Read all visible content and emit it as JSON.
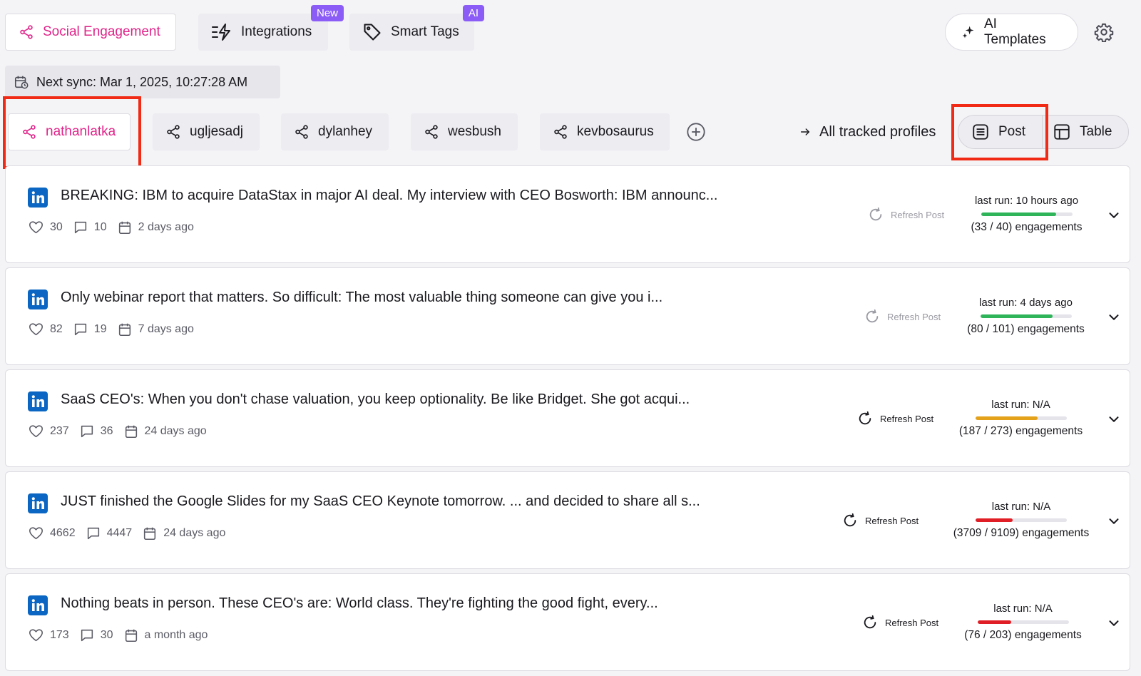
{
  "top_tabs": {
    "social": "Social Engagement",
    "integrations": "Integrations",
    "integrations_badge": "New",
    "smart_tags": "Smart Tags",
    "smart_tags_badge": "AI"
  },
  "ai_templates": "AI Templates",
  "sync": "Next sync: Mar 1, 2025, 10:27:28 AM",
  "profiles": [
    "nathanlatka",
    "ugljesadj",
    "dylanhey",
    "wesbush",
    "kevbosaurus"
  ],
  "all_profiles": "All tracked profiles",
  "view": {
    "post": "Post",
    "table": "Table"
  },
  "colors": {
    "accent": "#e0248a",
    "badge": "#8b5cf6",
    "green": "#2fb45a",
    "orange": "#e3a21a",
    "red": "#e01e25",
    "linkedin": "#0a66c2"
  },
  "posts": [
    {
      "text": "BREAKING: IBM to acquire DataStax in major AI deal. My interview with CEO Bosworth: IBM announc...",
      "likes": "30",
      "comments": "10",
      "date": "2 days ago",
      "refresh": "Refresh Post",
      "last_run": "last run: 10 hours ago",
      "engagements": "(33 / 40) engagements",
      "progress": 0.825
    },
    {
      "text": "Only webinar report that matters. So difficult: The most valuable thing someone can give you i...",
      "likes": "82",
      "comments": "19",
      "date": "7 days ago",
      "refresh": "Refresh Post",
      "last_run": "last run: 4 days ago",
      "engagements": "(80 / 101) engagements",
      "progress": 0.792
    },
    {
      "text": "SaaS CEO's: When you don't chase valuation, you keep optionality. Be like Bridget. She got acqui...",
      "likes": "237",
      "comments": "36",
      "date": "24 days ago",
      "refresh": "Refresh Post",
      "last_run": "last run: N/A",
      "engagements": "(187 / 273) engagements",
      "progress": 0.685
    },
    {
      "text": "JUST finished the Google Slides for my SaaS CEO Keynote tomorrow. ... and decided to share all s...",
      "likes": "4662",
      "comments": "4447",
      "date": "24 days ago",
      "refresh": "Refresh Post",
      "last_run": "last run: N/A",
      "engagements": "(3709 / 9109) engagements",
      "progress": 0.407
    },
    {
      "text": "Nothing beats in person. These CEO's are: World class. They're fighting the good fight, every...",
      "likes": "173",
      "comments": "30",
      "date": "a month ago",
      "refresh": "Refresh Post",
      "last_run": "last run: N/A",
      "engagements": "(76 / 203) engagements",
      "progress": 0.374
    }
  ]
}
